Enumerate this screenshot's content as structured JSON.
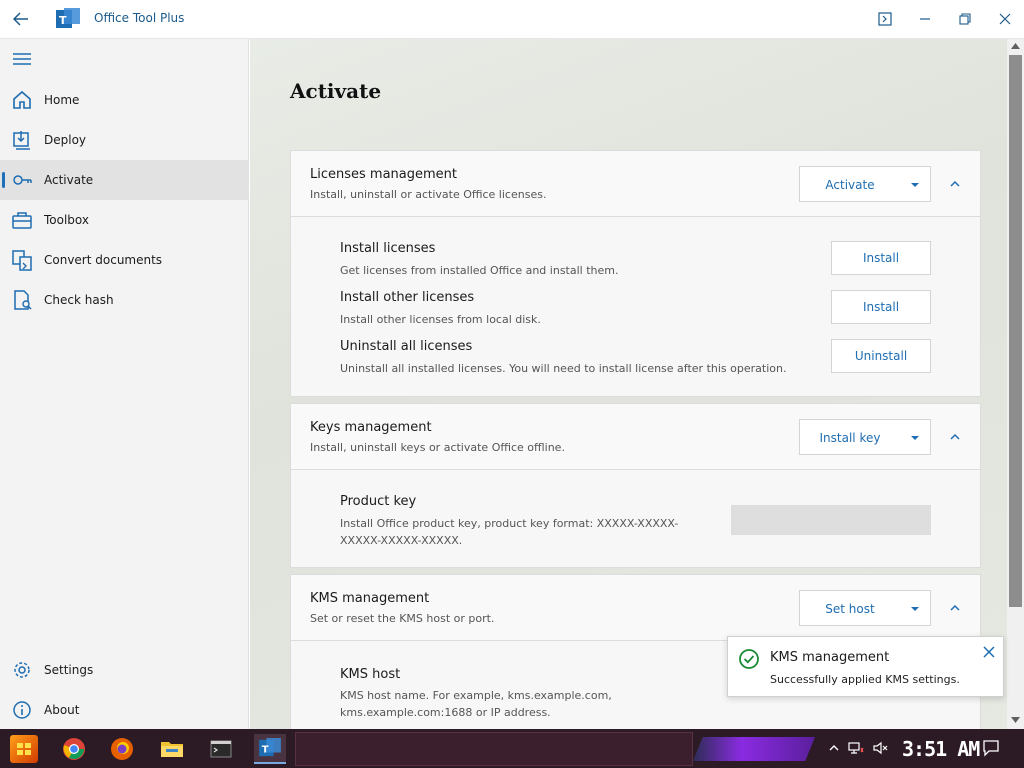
{
  "window": {
    "title": "Office Tool Plus"
  },
  "sidebar": {
    "items": [
      {
        "label": "Home",
        "icon": "home-icon"
      },
      {
        "label": "Deploy",
        "icon": "deploy-icon"
      },
      {
        "label": "Activate",
        "icon": "key-icon",
        "active": true
      },
      {
        "label": "Toolbox",
        "icon": "toolbox-icon"
      },
      {
        "label": "Convert documents",
        "icon": "convert-icon"
      },
      {
        "label": "Check hash",
        "icon": "hash-icon"
      }
    ],
    "bottom_items": [
      {
        "label": "Settings",
        "icon": "gear-icon"
      },
      {
        "label": "About",
        "icon": "info-icon"
      }
    ]
  },
  "page": {
    "title": "Activate"
  },
  "licenses": {
    "title": "Licenses management",
    "desc": "Install, uninstall or activate Office licenses.",
    "split_label": "Activate",
    "rows": [
      {
        "title": "Install licenses",
        "desc": "Get licenses from installed Office and install them.",
        "button": "Install"
      },
      {
        "title": "Install other licenses",
        "desc": "Install other licenses from local disk.",
        "button": "Install"
      },
      {
        "title": "Uninstall all licenses",
        "desc": "Uninstall all installed licenses. You will need to install license after this operation.",
        "button": "Uninstall"
      }
    ]
  },
  "keys": {
    "title": "Keys management",
    "desc": "Install, uninstall keys or activate Office offline.",
    "split_label": "Install key",
    "product_key_title": "Product key",
    "product_key_desc_1": "Install Office product key, product key format: XXXXX-XXXXX-",
    "product_key_desc_2": "XXXXX-XXXXX-XXXXX.",
    "product_key_value": ""
  },
  "kms": {
    "title": "KMS management",
    "desc": "Set or reset the KMS host or port.",
    "split_label": "Set host",
    "host_title": "KMS host",
    "host_desc_1": "KMS host name. For example, kms.example.com,",
    "host_desc_2": "kms.example.com:1688 or IP address."
  },
  "toast": {
    "title": "KMS management",
    "message": "Successfully applied KMS settings."
  },
  "taskbar": {
    "clock": "3:51 AM"
  },
  "colors": {
    "accent": "#1e6db2",
    "success": "#1a8a34",
    "sidebar_bg": "#f3f3f3"
  }
}
